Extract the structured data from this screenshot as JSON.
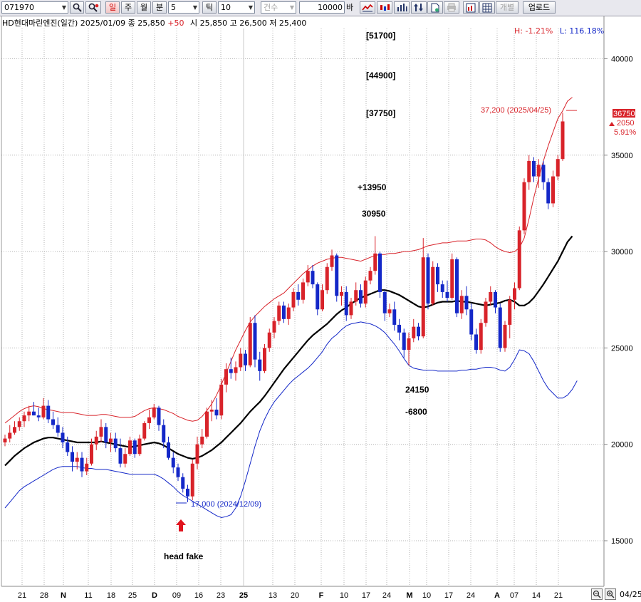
{
  "toolbar": {
    "code": "071970",
    "period_buttons": [
      "일",
      "주",
      "월",
      "분"
    ],
    "minute_value": "5",
    "tick_label": "틱",
    "tick_value": "10",
    "count_label": "건수",
    "amount_value": "10000",
    "amount_unit": "바",
    "individual_label": "개별",
    "upload_label": "업로드"
  },
  "header": {
    "stock_line": "HD현대마린엔진(일간) 2025/01/09  종 25,850",
    "change": "+50",
    "ohl": "시 25,850 고 26,500 저 25,400",
    "high_pct": "H: -1.21%",
    "low_pct": "L: 116.18%"
  },
  "price_tag": {
    "price": "36750",
    "change": "2050",
    "pct": "5.91%"
  },
  "annotations": {
    "t1": "[51700]",
    "t2": "[44900]",
    "t3": "[37750]",
    "plus": "+13950",
    "v30950": "30950",
    "v24150": "24150",
    "minus": "-6800",
    "head_fake": "head fake",
    "max_label": "37,200 (2025/04/25)",
    "min_label": "17,000 (2024/12/09)"
  },
  "bottom_right_date": "04/25",
  "colors": {
    "up": "#d8232a",
    "down": "#1428c8",
    "ma": "#000000",
    "band_up": "#d8232a",
    "band_low": "#1428c8"
  },
  "chart_data": {
    "type": "candlestick",
    "y_ticks": [
      15000,
      20000,
      25000,
      30000,
      35000,
      40000
    ],
    "y_range": [
      12000,
      43000
    ],
    "x_tick_labels": [
      "21",
      "28",
      "N",
      "11",
      "18",
      "25",
      "D",
      "09",
      "16",
      "23",
      "25",
      "13",
      "20",
      "F",
      "10",
      "17",
      "24",
      "M",
      "10",
      "17",
      "24",
      "A",
      "07",
      "14",
      "21"
    ],
    "candles": [
      [
        20100,
        20500,
        19900,
        20300
      ],
      [
        20300,
        21000,
        20100,
        20600
      ],
      [
        20600,
        21200,
        20500,
        20900
      ],
      [
        20900,
        21400,
        20700,
        21200
      ],
      [
        21200,
        21700,
        20900,
        21500
      ],
      [
        21500,
        22000,
        21200,
        21700
      ],
      [
        21700,
        22200,
        21500,
        21500
      ],
      [
        21500,
        21900,
        21200,
        21400
      ],
      [
        21400,
        22400,
        21300,
        22000
      ],
      [
        22000,
        22300,
        21100,
        21300
      ],
      [
        21300,
        21700,
        20800,
        21000
      ],
      [
        21000,
        21400,
        20400,
        20600
      ],
      [
        20600,
        20900,
        19800,
        20100
      ],
      [
        20100,
        20400,
        19400,
        19600
      ],
      [
        19600,
        19900,
        18600,
        19100
      ],
      [
        19100,
        19600,
        18700,
        19300
      ],
      [
        19300,
        19600,
        18300,
        18600
      ],
      [
        18600,
        19300,
        18400,
        19000
      ],
      [
        19000,
        20300,
        18900,
        20000
      ],
      [
        20000,
        20700,
        19700,
        20400
      ],
      [
        20400,
        21300,
        20100,
        20900
      ],
      [
        20900,
        21100,
        19800,
        20100
      ],
      [
        20100,
        20600,
        19600,
        20300
      ],
      [
        20300,
        20600,
        19600,
        19800
      ],
      [
        19800,
        20300,
        18800,
        19000
      ],
      [
        19000,
        19800,
        18800,
        19500
      ],
      [
        19500,
        20400,
        19400,
        20200
      ],
      [
        20200,
        20300,
        19300,
        19500
      ],
      [
        19500,
        20500,
        19400,
        20300
      ],
      [
        20300,
        21200,
        20200,
        21100
      ],
      [
        21100,
        21800,
        20800,
        21400
      ],
      [
        21400,
        22100,
        21300,
        21900
      ],
      [
        21900,
        22000,
        20700,
        21000
      ],
      [
        21000,
        21300,
        19800,
        20100
      ],
      [
        20100,
        20400,
        19200,
        19300
      ],
      [
        19300,
        19600,
        18500,
        18800
      ],
      [
        18800,
        19000,
        18100,
        18300
      ],
      [
        18300,
        18500,
        17500,
        17700
      ],
      [
        17700,
        17900,
        17000,
        17300
      ],
      [
        17300,
        19200,
        17100,
        19000
      ],
      [
        19000,
        20400,
        18700,
        20000
      ],
      [
        20000,
        20800,
        19800,
        20400
      ],
      [
        20400,
        21900,
        20300,
        21700
      ],
      [
        21700,
        22300,
        21200,
        21800
      ],
      [
        21800,
        22400,
        21300,
        21500
      ],
      [
        21500,
        23400,
        21300,
        23100
      ],
      [
        23100,
        24200,
        22700,
        23900
      ],
      [
        23900,
        24500,
        23400,
        23700
      ],
      [
        23700,
        24300,
        23300,
        24000
      ],
      [
        24000,
        25000,
        23800,
        24700
      ],
      [
        24700,
        24900,
        23800,
        24100
      ],
      [
        24100,
        26600,
        24000,
        26300
      ],
      [
        26300,
        26700,
        24000,
        24400
      ],
      [
        24400,
        24800,
        23300,
        23800
      ],
      [
        23800,
        25200,
        23700,
        25000
      ],
      [
        25000,
        26000,
        24800,
        25800
      ],
      [
        25800,
        26600,
        25500,
        26400
      ],
      [
        26400,
        27400,
        26200,
        27200
      ],
      [
        27200,
        27400,
        26300,
        26500
      ],
      [
        26500,
        27300,
        26200,
        27100
      ],
      [
        27100,
        28100,
        26900,
        27900
      ],
      [
        27900,
        28300,
        27200,
        27500
      ],
      [
        27500,
        28600,
        27300,
        28400
      ],
      [
        28400,
        29300,
        28200,
        29000
      ],
      [
        29000,
        29300,
        28100,
        28300
      ],
      [
        28300,
        28400,
        26700,
        27000
      ],
      [
        27000,
        28300,
        26900,
        28000
      ],
      [
        28000,
        29400,
        27800,
        29200
      ],
      [
        29200,
        30100,
        29000,
        29800
      ],
      [
        29800,
        29900,
        27400,
        27700
      ],
      [
        27700,
        28200,
        27200,
        27900
      ],
      [
        27900,
        28200,
        26400,
        26700
      ],
      [
        26700,
        27600,
        26500,
        27400
      ],
      [
        27400,
        28400,
        27200,
        28000
      ],
      [
        28000,
        28300,
        27100,
        27300
      ],
      [
        27300,
        28700,
        27100,
        28500
      ],
      [
        28500,
        29200,
        28300,
        29000
      ],
      [
        29000,
        30800,
        28800,
        29900
      ],
      [
        29900,
        30000,
        27600,
        27900
      ],
      [
        27900,
        28000,
        26400,
        26800
      ],
      [
        26800,
        27300,
        26600,
        27000
      ],
      [
        27000,
        27400,
        25900,
        26200
      ],
      [
        26200,
        26500,
        25400,
        25800
      ],
      [
        25800,
        26000,
        24500,
        24900
      ],
      [
        24900,
        25800,
        24100,
        25500
      ],
      [
        25500,
        26500,
        25300,
        26100
      ],
      [
        26100,
        26300,
        25400,
        25600
      ],
      [
        25600,
        30700,
        25500,
        29700
      ],
      [
        29700,
        29900,
        27000,
        27300
      ],
      [
        27300,
        29500,
        27200,
        29200
      ],
      [
        29200,
        29400,
        27900,
        28300
      ],
      [
        28300,
        28500,
        27600,
        27900
      ],
      [
        27900,
        28500,
        27400,
        27600
      ],
      [
        27600,
        29900,
        27500,
        29600
      ],
      [
        29600,
        29700,
        26600,
        26800
      ],
      [
        26800,
        28000,
        26500,
        27700
      ],
      [
        27700,
        28200,
        26700,
        27000
      ],
      [
        27000,
        27300,
        25400,
        25700
      ],
      [
        25700,
        26000,
        24700,
        24900
      ],
      [
        24900,
        26500,
        24700,
        26300
      ],
      [
        26300,
        27600,
        26100,
        27400
      ],
      [
        27400,
        28200,
        27200,
        27900
      ],
      [
        27900,
        28000,
        26800,
        27100
      ],
      [
        27100,
        27300,
        24800,
        25000
      ],
      [
        25000,
        26400,
        24800,
        26200
      ],
      [
        26200,
        27700,
        25500,
        27500
      ],
      [
        27500,
        28400,
        27000,
        28100
      ],
      [
        28100,
        31300,
        28000,
        31100
      ],
      [
        31100,
        33800,
        30900,
        33600
      ],
      [
        33600,
        35000,
        33200,
        34700
      ],
      [
        34700,
        34900,
        33600,
        33900
      ],
      [
        33900,
        34800,
        33300,
        34500
      ],
      [
        34500,
        34700,
        33200,
        33600
      ],
      [
        33600,
        33800,
        32200,
        32500
      ],
      [
        32500,
        34200,
        32300,
        33900
      ],
      [
        33900,
        35000,
        33700,
        34800
      ],
      [
        34800,
        37200,
        34700,
        36750
      ]
    ],
    "ma": [
      18900,
      19150,
      19400,
      19600,
      19800,
      19950,
      20100,
      20200,
      20300,
      20350,
      20350,
      20300,
      20250,
      20200,
      20150,
      20100,
      20100,
      20100,
      20100,
      20100,
      20150,
      20100,
      20050,
      20000,
      19950,
      19900,
      19850,
      19900,
      19950,
      20000,
      20050,
      20100,
      20050,
      19950,
      19800,
      19650,
      19500,
      19400,
      19300,
      19250,
      19300,
      19400,
      19550,
      19700,
      19900,
      20100,
      20350,
      20600,
      20850,
      21100,
      21400,
      21700,
      21950,
      22200,
      22500,
      22850,
      23200,
      23550,
      23900,
      24200,
      24500,
      24800,
      25100,
      25400,
      25650,
      25850,
      26050,
      26250,
      26500,
      26750,
      26950,
      27100,
      27300,
      27450,
      27600,
      27700,
      27800,
      27900,
      28000,
      28000,
      27950,
      27850,
      27750,
      27600,
      27450,
      27300,
      27150,
      27100,
      27150,
      27250,
      27350,
      27400,
      27400,
      27400,
      27450,
      27400,
      27400,
      27350,
      27300,
      27250,
      27200,
      27250,
      27300,
      27350,
      27450,
      27500,
      27400,
      27200,
      27200,
      27350,
      27600,
      27950,
      28300,
      28700,
      29100,
      29500,
      30000,
      30500,
      30800
    ],
    "upper": [
      21100,
      21300,
      21500,
      21700,
      21850,
      21950,
      22000,
      21950,
      21850,
      21800,
      21750,
      21700,
      21650,
      21650,
      21650,
      21600,
      21550,
      21500,
      21500,
      21500,
      21550,
      21550,
      21500,
      21450,
      21400,
      21400,
      21400,
      21450,
      21600,
      21750,
      21850,
      21900,
      21850,
      21800,
      21700,
      21600,
      21450,
      21350,
      21250,
      21200,
      21250,
      21450,
      21750,
      22100,
      22550,
      23100,
      23700,
      24300,
      24900,
      25400,
      25900,
      26350,
      26650,
      26900,
      27150,
      27350,
      27550,
      27700,
      27850,
      28100,
      28350,
      28600,
      28850,
      29050,
      29250,
      29400,
      29500,
      29600,
      29650,
      29700,
      29700,
      29650,
      29600,
      29550,
      29500,
      29600,
      29700,
      29800,
      29850,
      29850,
      29900,
      29900,
      29950,
      30000,
      30000,
      30050,
      30100,
      30200,
      30300,
      30350,
      30400,
      30450,
      30450,
      30500,
      30550,
      30550,
      30550,
      30600,
      30650,
      30650,
      30600,
      30450,
      30250,
      30100,
      30000,
      29950,
      30000,
      30200,
      30700,
      31700,
      32800,
      33800,
      34700,
      35500,
      36200,
      36900,
      37300,
      37800,
      38000
    ],
    "lower": [
      16700,
      17000,
      17300,
      17600,
      17800,
      17950,
      18100,
      18250,
      18400,
      18550,
      18700,
      18800,
      18850,
      18850,
      18850,
      18850,
      18800,
      18750,
      18750,
      18700,
      18700,
      18700,
      18650,
      18600,
      18550,
      18500,
      18450,
      18450,
      18450,
      18450,
      18450,
      18450,
      18350,
      18200,
      18000,
      17800,
      17550,
      17350,
      17200,
      17050,
      16900,
      16750,
      16600,
      16450,
      16300,
      16200,
      16250,
      16350,
      16700,
      17300,
      18100,
      19000,
      19900,
      20700,
      21300,
      21800,
      22200,
      22500,
      22800,
      23100,
      23350,
      23550,
      23750,
      23950,
      24200,
      24500,
      24800,
      25200,
      25500,
      25700,
      25950,
      26150,
      26250,
      26300,
      26350,
      26300,
      26250,
      26150,
      26000,
      25800,
      25500,
      25200,
      24850,
      24450,
      24100,
      23950,
      23900,
      23850,
      23850,
      23850,
      23800,
      23800,
      23800,
      23800,
      23800,
      23850,
      23850,
      23900,
      23900,
      23950,
      24000,
      24000,
      23950,
      23850,
      23800,
      24000,
      24400,
      24900,
      24850,
      24700,
      24300,
      23800,
      23300,
      22900,
      22650,
      22400,
      22400,
      22550,
      22850,
      23300
    ]
  }
}
